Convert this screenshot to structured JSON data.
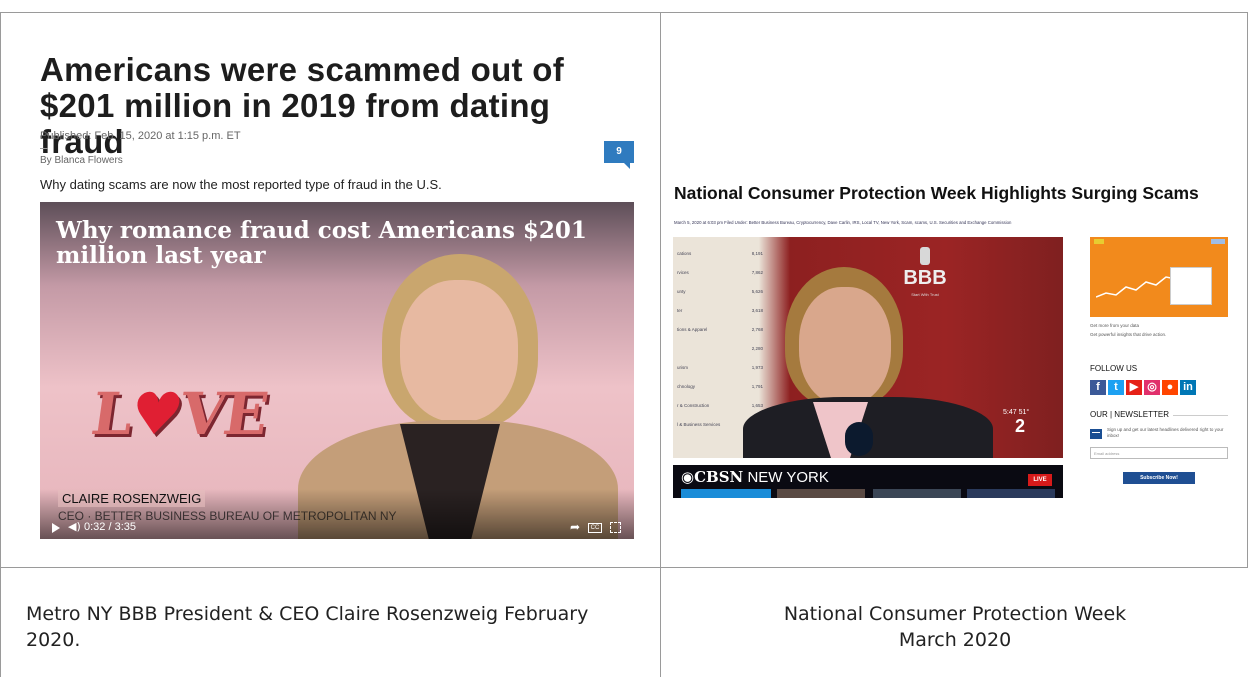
{
  "left": {
    "headline": "Americans were scammed out of $201 million in 2019 from dating fraud",
    "published": "Published: Feb. 15, 2020 at 1:15 p.m. ET",
    "byline": "By Blanca Flowers",
    "comment_count": "9",
    "dek": "Why dating scams are now the most reported type of fraud in the U.S.",
    "video": {
      "title": "Why romance fraud cost Americans $201 million last year",
      "graphic_text": "LOVE",
      "name": "CLAIRE ROSENZWEIG",
      "role": "CEO · BETTER BUSINESS BUREAU OF METROPOLITAN NY",
      "time": "0:32 / 3:35",
      "icons": [
        "play-icon",
        "volume-icon",
        "share-icon",
        "captions-icon",
        "fullscreen-icon"
      ]
    }
  },
  "right": {
    "headline": "National Consumer Protection Week Highlights Surging Scams",
    "meta": "March 5, 2020 at 6:03 pm    Filed Under: Better Business Bureau, Cryptocurrency, Dave Carlin, IRS, Local TV, New York, Scam, scams, U.S. Securities and Exchange Commission",
    "video": {
      "stats": [
        {
          "label": "cations",
          "value": "8,191"
        },
        {
          "label": "rvices",
          "value": "7,862"
        },
        {
          "label": "unty",
          "value": "5,626"
        },
        {
          "label": "ter",
          "value": "3,618"
        },
        {
          "label": "tions & Apparel",
          "value": "2,768"
        },
        {
          "label": "",
          "value": "2,280"
        },
        {
          "label": "urism",
          "value": "1,973"
        },
        {
          "label": "chnology",
          "value": "1,791"
        },
        {
          "label": "r & Construction",
          "value": "1,653"
        },
        {
          "label": "l & Business Services",
          "value": "1,361"
        }
      ],
      "bbb_logo": "BBB",
      "bbb_tagline": "Start With Trust",
      "bug_time": "5:47  51°",
      "bug_channel": "2",
      "cbsn_brand": "CBSN",
      "cbsn_city": "NEW YORK",
      "live": "LIVE"
    },
    "sidebar": {
      "ad_text1": "Get more from your data",
      "ad_text2": "Get powerful insights that drive action.",
      "follow_title": "FOLLOW US",
      "social": [
        {
          "icon": "facebook-icon",
          "glyph": "f",
          "color": "#3b5998"
        },
        {
          "icon": "twitter-icon",
          "glyph": "t",
          "color": "#1da1f2"
        },
        {
          "icon": "youtube-icon",
          "glyph": "▶",
          "color": "#e62117"
        },
        {
          "icon": "instagram-icon",
          "glyph": "◎",
          "color": "#e1306c"
        },
        {
          "icon": "reddit-icon",
          "glyph": "●",
          "color": "#ff4500"
        },
        {
          "icon": "linkedin-icon",
          "glyph": "in",
          "color": "#0077b5"
        }
      ],
      "newsletter_title": "OUR | NEWSLETTER",
      "newsletter_desc": "Sign up and get our latest headlines delivered right to your inbox!",
      "email_placeholder": "Email address",
      "subscribe_label": "Subscribe Now!"
    }
  },
  "captions": {
    "left": "Metro NY BBB President & CEO Claire Rosenzweig February 2020.",
    "right_line1": "National Consumer Protection Week",
    "right_line2": "March 2020"
  }
}
